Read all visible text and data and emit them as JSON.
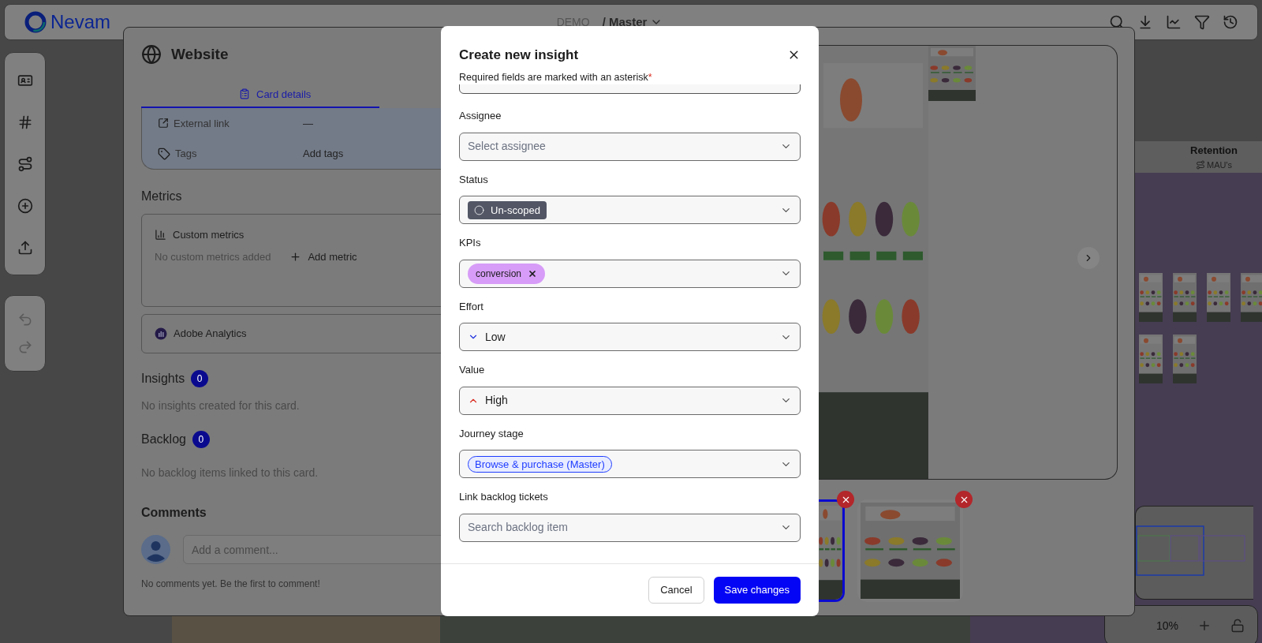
{
  "topbar": {
    "logo": "Nevam",
    "project": "DEMO",
    "board": "/ Master"
  },
  "canvas": {
    "column_title": "Retention",
    "column_metric": "MAU's",
    "zoom": "10%"
  },
  "panel": {
    "title": "Website",
    "tabs": [
      {
        "label": "Card details",
        "selected": true
      }
    ],
    "details": [
      {
        "kind": "link",
        "label": "External link",
        "value": "—"
      },
      {
        "kind": "tags",
        "label": "Tags",
        "value": "Add tags"
      }
    ],
    "metrics_heading": "Metrics",
    "custom_metrics": {
      "title": "Custom metrics",
      "empty": "No custom metrics added",
      "action": "Add metric"
    },
    "integration": "Adobe Analytics",
    "sections": [
      {
        "heading": "Insights",
        "count": "0",
        "empty": "No insights created for this card."
      },
      {
        "heading": "Backlog",
        "count": "0",
        "empty": "No backlog items linked to this card."
      }
    ],
    "comments": {
      "heading": "Comments",
      "placeholder": "Add a comment...",
      "empty": "No comments yet. Be the first to comment!"
    },
    "thumbnails": [
      {
        "selected": true
      },
      {
        "selected": false
      }
    ]
  },
  "modal": {
    "title": "Create new insight",
    "note": "Required fields are marked with an asterisk",
    "required_mark": "*",
    "fields": [
      {
        "kind": "select",
        "label": "Assignee",
        "placeholder": "Select assignee"
      },
      {
        "kind": "status",
        "label": "Status",
        "value": "Un-scoped"
      },
      {
        "kind": "tags",
        "label": "KPIs",
        "tags": [
          "conversion"
        ]
      },
      {
        "kind": "priority",
        "label": "Effort",
        "value": "Low",
        "ascending": false
      },
      {
        "kind": "priority",
        "label": "Value",
        "value": "High",
        "ascending": true
      },
      {
        "kind": "stage",
        "label": "Journey stage",
        "value": "Browse & purchase (Master)"
      },
      {
        "kind": "search",
        "label": "Link backlog tickets",
        "placeholder": "Search backlog item"
      }
    ],
    "buttons": [
      {
        "kind": "secondary",
        "label": "Cancel"
      },
      {
        "kind": "primary",
        "label": "Save changes"
      }
    ]
  }
}
